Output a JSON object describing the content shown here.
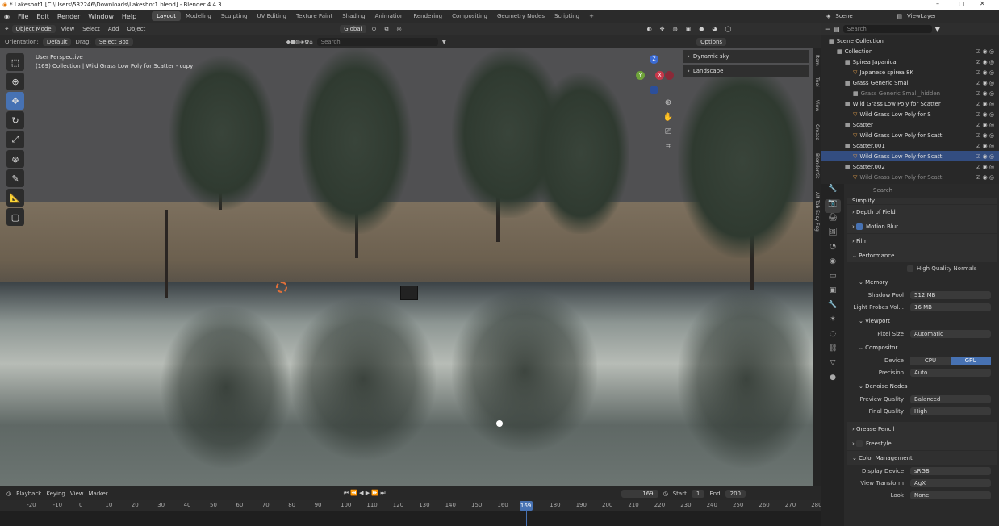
{
  "window": {
    "title": "* Lakeshot1 [C:\\Users\\532246\\Downloads\\Lakeshot1.blend] - Blender 4.4.3",
    "controls": [
      "–",
      "▢",
      "✕"
    ]
  },
  "menu": {
    "items": [
      "File",
      "Edit",
      "Render",
      "Window",
      "Help"
    ],
    "workspaces": [
      "Layout",
      "Modeling",
      "Sculpting",
      "UV Editing",
      "Texture Paint",
      "Shading",
      "Animation",
      "Rendering",
      "Compositing",
      "Geometry Nodes",
      "Scripting"
    ],
    "add_ws": "+"
  },
  "viewport_header": {
    "mode": "Object Mode",
    "menus": [
      "View",
      "Select",
      "Add",
      "Object"
    ],
    "orientation_btn": "Global",
    "options": "Options"
  },
  "tool_settings": {
    "orientation_label": "Orientation:",
    "orientation_value": "Default",
    "drag_label": "Drag:",
    "drag_value": "Select Box",
    "search_placeholder": "Search"
  },
  "viewport": {
    "perspective": "User Perspective",
    "collection_line": "(169) Collection | Wild Grass Low Poly for Scatter - copy"
  },
  "npanel": {
    "items": [
      "Dynamic sky",
      "Landscape"
    ]
  },
  "side_tabs": [
    "Item",
    "Tool",
    "View",
    "Create",
    "BlenderKit",
    "Alt Tab Easy Fog"
  ],
  "gizmo": {
    "x": "X",
    "y": "Y",
    "z": "Z"
  },
  "timeline": {
    "menus": [
      "Playback",
      "Keying",
      "View",
      "Marker"
    ],
    "current": "169",
    "start_label": "Start",
    "start": "1",
    "end_label": "End",
    "end": "200",
    "ticks": [
      "-20",
      "-10",
      "0",
      "10",
      "20",
      "30",
      "40",
      "50",
      "60",
      "70",
      "80",
      "90",
      "100",
      "110",
      "120",
      "130",
      "140",
      "150",
      "160",
      "180",
      "190",
      "200",
      "210",
      "220",
      "230",
      "240",
      "250",
      "260",
      "270",
      "280"
    ]
  },
  "outliner_header": {
    "scene": "Scene",
    "view_layer": "ViewLayer"
  },
  "outliner": {
    "search_placeholder": "Search",
    "rows": [
      {
        "label": "Scene Collection",
        "indent": 0,
        "icon": "▦"
      },
      {
        "label": "Collection",
        "indent": 1,
        "icon": "▦"
      },
      {
        "label": "Spirea Japanica",
        "indent": 2,
        "icon": "▦"
      },
      {
        "label": "Japanese spirea 8K",
        "indent": 3,
        "icon": "▽"
      },
      {
        "label": "Grass Generic Small",
        "indent": 2,
        "icon": "▦"
      },
      {
        "label": "Grass Generic Small_hidden",
        "indent": 3,
        "icon": "▦"
      },
      {
        "label": "Wild Grass Low Poly for Scatter",
        "indent": 2,
        "icon": "▦"
      },
      {
        "label": "Wild Grass Low Poly for S",
        "indent": 3,
        "icon": "▽"
      },
      {
        "label": "Scatter",
        "indent": 2,
        "icon": "▦"
      },
      {
        "label": "Wild Grass Low Poly for Scatt",
        "indent": 3,
        "icon": "▽"
      },
      {
        "label": "Scatter.001",
        "indent": 2,
        "icon": "▦"
      },
      {
        "label": "Wild Grass Low Poly for Scatt",
        "indent": 3,
        "icon": "▽"
      },
      {
        "label": "Scatter.002",
        "indent": 2,
        "icon": "▦"
      },
      {
        "label": "Wild Grass Low Poly for Scatt",
        "indent": 3,
        "icon": "▽"
      }
    ]
  },
  "properties": {
    "search_placeholder": "Search",
    "simplify": "Simplify",
    "dof": "Depth of Field",
    "motion_blur": "Motion Blur",
    "film": "Film",
    "performance": "Performance",
    "hq_normals": "High Quality Normals",
    "memory": "Memory",
    "shadow_pool_label": "Shadow Pool",
    "shadow_pool": "512 MB",
    "light_probes_label": "Light Probes Vol...",
    "light_probes": "16 MB",
    "viewport": "Viewport",
    "pixel_size_label": "Pixel Size",
    "pixel_size": "Automatic",
    "compositor": "Compositor",
    "device_label": "Device",
    "device_cpu": "CPU",
    "device_gpu": "GPU",
    "precision_label": "Precision",
    "precision": "Auto",
    "denoise": "Denoise Nodes",
    "preview_quality_label": "Preview Quality",
    "preview_quality": "Balanced",
    "final_quality_label": "Final Quality",
    "final_quality": "High",
    "grease_pencil": "Grease Pencil",
    "freestyle": "Freestyle",
    "color_mgmt": "Color Management",
    "display_device_label": "Display Device",
    "display_device": "sRGB",
    "view_transform_label": "View Transform",
    "view_transform": "AgX",
    "look_label": "Look",
    "look": "None"
  },
  "colors": {
    "accent": "#4772b3",
    "selection": "#334d80"
  }
}
